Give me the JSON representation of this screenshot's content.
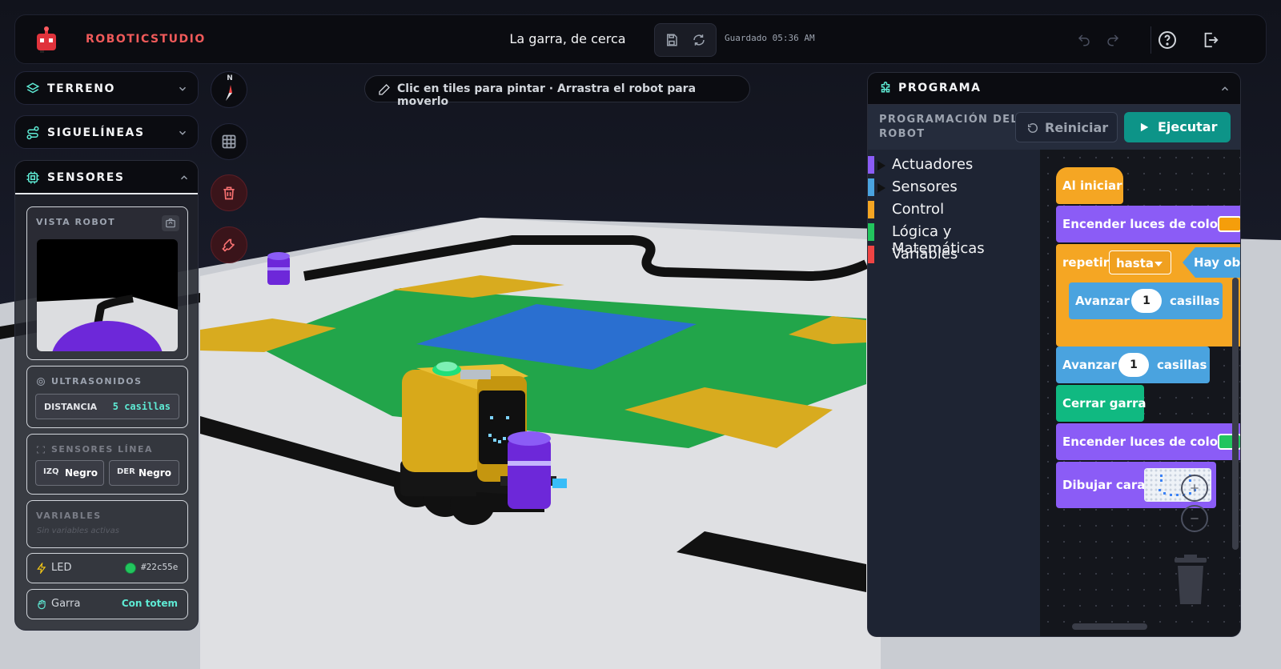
{
  "header": {
    "brand": "ROBOTICSTUDIO",
    "project_title": "La garra, de cerca",
    "saved_status": "Guardado 05:36 AM"
  },
  "left_panels": {
    "terrain_label": "TERRENO",
    "linefollower_label": "SIGUELÍNEAS",
    "sensors_label": "SENSORES"
  },
  "sensors": {
    "robot_view_title": "VISTA ROBOT",
    "ultrasonic_title": "ULTRASONIDOS",
    "distance_label": "DISTANCIA",
    "distance_value": "5 casillas",
    "line_sensors_title": "SENSORES LÍNEA",
    "left_label": "IZQ",
    "left_value": "Negro",
    "right_label": "DER",
    "right_value": "Negro",
    "variables_title": "VARIABLES",
    "variables_empty": "Sin variables activas",
    "led_label": "LED",
    "led_value": "#22c55e",
    "claw_label": "Garra",
    "claw_value": "Con totem"
  },
  "compass_label": "N",
  "hint_text": "Clic en tiles para pintar · Arrastra el robot para moverlo",
  "program": {
    "title": "PROGRAMA",
    "subtitle": "PROGRAMACIÓN DEL ROBOT",
    "reset_label": "Reiniciar",
    "run_label": "Ejecutar",
    "categories": [
      {
        "label": "Actuadores",
        "color": "#8b5cf6"
      },
      {
        "label": "Sensores",
        "color": "#4aa3df"
      },
      {
        "label": "Control",
        "color": "#f5a623"
      },
      {
        "label": "Lógica y Matemáticas",
        "color": "#22c55e"
      },
      {
        "label": "Variables",
        "color": "#ef4444"
      }
    ],
    "blocks": {
      "on_start": "Al iniciar",
      "lights1": "Encender luces de color",
      "repeat": "repetir",
      "repeat_mode": "hasta",
      "obstacle": "Hay obs",
      "advance_inner": "Avanzar",
      "advance_inner_n": "1",
      "advance_inner_unit": "casillas",
      "advance": "Avanzar",
      "advance_n": "1",
      "advance_unit": "casillas",
      "close_claw": "Cerrar garra",
      "lights2": "Encender luces de color",
      "draw_face": "Dibujar cara"
    }
  },
  "colors": {
    "accent_red": "#f05a5a",
    "run_green": "#0d9488",
    "led_green": "#22c55e",
    "block_purple": "#8b5cf6",
    "block_orange": "#f5a623",
    "block_blue": "#4aa3df",
    "block_teal": "#10b981"
  },
  "icons": [
    "robot-logo-icon",
    "save-icon",
    "sync-icon",
    "undo-icon",
    "redo-icon",
    "help-icon",
    "logout-icon",
    "layers-icon",
    "route-icon",
    "chip-icon",
    "chevron-down-icon",
    "chevron-up-icon",
    "camera-switch-icon",
    "compass-icon",
    "grid-icon",
    "trash-icon",
    "wrench-icon",
    "pencil-icon",
    "puzzle-icon",
    "reset-icon",
    "play-icon",
    "zap-icon",
    "hand-icon"
  ]
}
